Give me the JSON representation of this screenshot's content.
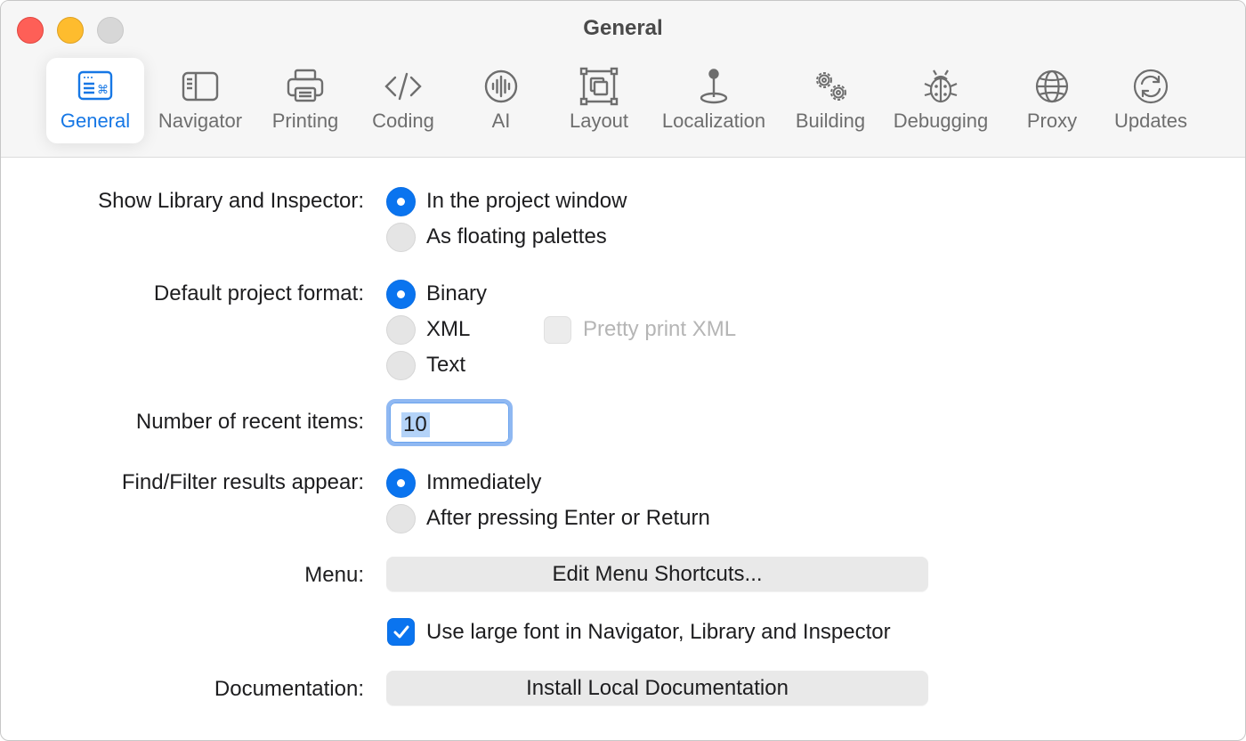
{
  "window": {
    "title": "General"
  },
  "tabs": [
    {
      "label": "General",
      "icon": "general-icon",
      "active": true
    },
    {
      "label": "Navigator",
      "icon": "sidebar-icon"
    },
    {
      "label": "Printing",
      "icon": "printer-icon"
    },
    {
      "label": "Coding",
      "icon": "code-brackets-icon"
    },
    {
      "label": "AI",
      "icon": "waveform-icon"
    },
    {
      "label": "Layout",
      "icon": "layout-icon"
    },
    {
      "label": "Localization",
      "icon": "location-pin-icon"
    },
    {
      "label": "Building",
      "icon": "gears-icon"
    },
    {
      "label": "Debugging",
      "icon": "ladybug-icon"
    },
    {
      "label": "Proxy",
      "icon": "globe-icon"
    },
    {
      "label": "Updates",
      "icon": "refresh-icon"
    }
  ],
  "form": {
    "library": {
      "label": "Show Library and Inspector:",
      "options": [
        "In the project window",
        "As floating palettes"
      ],
      "selected": "In the project window"
    },
    "format": {
      "label": "Default project format:",
      "options": [
        "Binary",
        "XML",
        "Text"
      ],
      "selected": "Binary",
      "pretty_print_label": "Pretty print XML",
      "pretty_print_checked": false,
      "pretty_print_enabled": false
    },
    "recent": {
      "label": "Number of recent items:",
      "value": "10"
    },
    "find": {
      "label": "Find/Filter results appear:",
      "options": [
        "Immediately",
        "After pressing Enter or Return"
      ],
      "selected": "Immediately"
    },
    "menu": {
      "label": "Menu:",
      "button_label": "Edit Menu Shortcuts..."
    },
    "large_font": {
      "label": "Use large font in Navigator, Library and Inspector",
      "checked": true
    },
    "documentation": {
      "label": "Documentation:",
      "button_label": "Install Local Documentation"
    }
  },
  "colors": {
    "accent": "#0a74ef",
    "close": "#fe5f57",
    "minimize": "#febc2e",
    "zoom_disabled": "#d7d7d7"
  }
}
